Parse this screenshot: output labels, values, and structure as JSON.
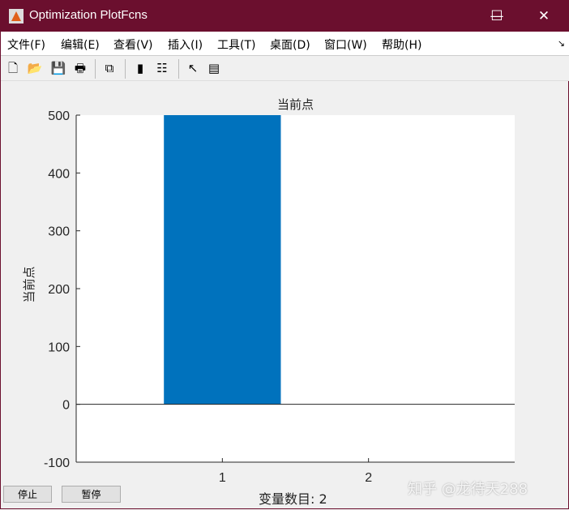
{
  "window": {
    "title": "Optimization PlotFcns",
    "minimize": "—",
    "maximize": "☐",
    "close": "✕"
  },
  "menu": [
    "文件(F)",
    "编辑(E)",
    "查看(V)",
    "插入(I)",
    "工具(T)",
    "桌面(D)",
    "窗口(W)",
    "帮助(H)"
  ],
  "menu_arrow": "↘",
  "toolbar": [
    {
      "icon": "new-file-icon",
      "g": "🗋"
    },
    {
      "icon": "open-folder-icon",
      "g": "📂"
    },
    {
      "icon": "save-icon",
      "g": "💾"
    },
    {
      "icon": "print-icon",
      "g": "🖶"
    },
    {
      "icon": "link-icon",
      "g": "⧉"
    },
    {
      "icon": "colorbar-icon",
      "g": "▮"
    },
    {
      "icon": "legend-icon",
      "g": "☷"
    },
    {
      "icon": "pointer-icon",
      "g": "↖"
    },
    {
      "icon": "property-inspector-icon",
      "g": "▤"
    }
  ],
  "chart_data": {
    "type": "bar",
    "title": "当前点",
    "xlabel": "",
    "ylabel": "当前点",
    "categories": [
      "1",
      "2"
    ],
    "x": [
      1,
      2
    ],
    "values": [
      500,
      0
    ],
    "xlim": [
      0,
      3
    ],
    "ylim": [
      -100,
      500
    ],
    "yticks": [
      "500",
      "400",
      "300",
      "200",
      "100",
      "0",
      "-100"
    ],
    "ytick_values": [
      500,
      400,
      300,
      200,
      100,
      0,
      -100
    ],
    "color": "#0072bd"
  },
  "buttons": {
    "stop": "停止",
    "pause": "暂停"
  },
  "status": "变量数目: 2",
  "watermark": "知乎 @龙待天288"
}
